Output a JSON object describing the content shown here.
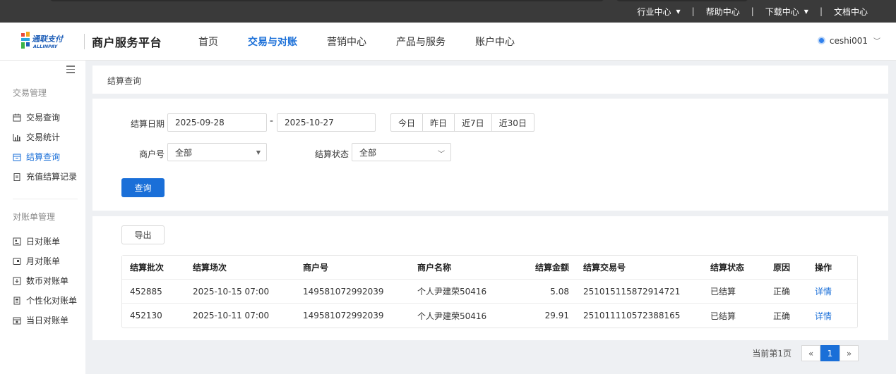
{
  "topnav": {
    "industry": "行业中心",
    "help": "帮助中心",
    "download": "下载中心",
    "docs": "文档中心",
    "separator": "|"
  },
  "header": {
    "logo_text_cn": "通联支付",
    "logo_text_en": "ALLINPAY",
    "brand": "商户服务平台",
    "nav": [
      "首页",
      "交易与对账",
      "营销中心",
      "产品与服务",
      "账户中心"
    ],
    "active_nav": "交易与对账",
    "user": "ceshi001"
  },
  "sidebar": {
    "group1": "交易管理",
    "group1_items": [
      "交易查询",
      "交易统计",
      "结算查询",
      "充值结算记录"
    ],
    "group2": "对账单管理",
    "group2_items": [
      "日对账单",
      "月对账单",
      "数币对账单",
      "个性化对账单",
      "当日对账单"
    ],
    "active_item": "结算查询"
  },
  "breadcrumb": "结算查询",
  "filter": {
    "date_label": "结算日期",
    "date_from": "2025-09-28",
    "date_sep": "-",
    "date_to": "2025-10-27",
    "quick": [
      "今日",
      "昨日",
      "近7日",
      "近30日"
    ],
    "merchant_label": "商户号",
    "merchant_value": "全部",
    "status_label": "结算状态",
    "status_value": "全部",
    "query_button": "查询"
  },
  "results": {
    "export_button": "导出",
    "columns": [
      "结算批次",
      "结算场次",
      "商户号",
      "商户名称",
      "结算金额",
      "结算交易号",
      "结算状态",
      "原因",
      "操作"
    ],
    "rows": [
      [
        "452885",
        "2025-10-15 07:00",
        "149581072992039",
        "个人尹建荣50416",
        "5.08",
        "251015115872914721",
        "已结算",
        "正确",
        "详情"
      ],
      [
        "452130",
        "2025-10-11 07:00",
        "149581072992039",
        "个人尹建荣50416",
        "29.91",
        "251011110572388165",
        "已结算",
        "正确",
        "详情"
      ]
    ]
  },
  "pager": {
    "info": "当前第1页",
    "prev": "«",
    "current": "1",
    "next": "»"
  },
  "colors": {
    "accent": "#1a6fd8",
    "topbar": "#3a3a3a"
  }
}
